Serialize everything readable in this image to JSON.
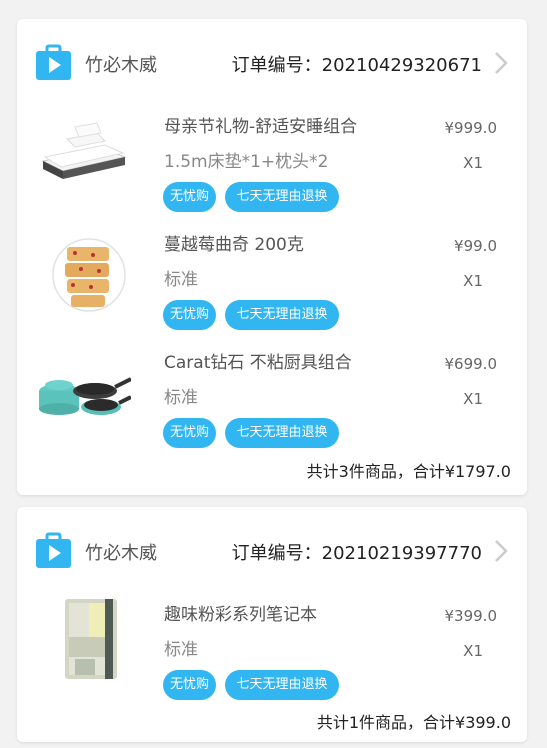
{
  "colors": {
    "accent": "#31b6f2",
    "background": "#f2f2f2",
    "card": "#ffffff"
  },
  "orders": [
    {
      "shop_icon": "play-bag-icon",
      "shop_name": "竹必木威",
      "order_no": "订单编号：20210429320671",
      "items": [
        {
          "image_icon": "bedding-set-image",
          "title": "母亲节礼物-舒适安睡组合",
          "spec": "1.5m床垫*1+枕头*2",
          "tag1": "无忧购",
          "tag2": "七天无理由退换",
          "price": "¥999.0",
          "qty": "X1"
        },
        {
          "image_icon": "cookie-plate-image",
          "title": "蔓越莓曲奇 200克",
          "spec": "标准",
          "tag1": "无忧购",
          "tag2": "七天无理由退换",
          "price": "¥99.0",
          "qty": "X1"
        },
        {
          "image_icon": "cookware-set-image",
          "title": "Carat钻石 不粘厨具组合",
          "spec": "标准",
          "tag1": "无忧购",
          "tag2": "七天无理由退换",
          "price": "¥699.0",
          "qty": "X1"
        }
      ],
      "summary": "共计3件商品，合计¥1797.0"
    },
    {
      "shop_icon": "play-bag-icon",
      "shop_name": "竹必木威",
      "order_no": "订单编号：20210219397770",
      "items": [
        {
          "image_icon": "notebook-image",
          "title": "趣味粉彩系列笔记本",
          "spec": "标准",
          "tag1": "无忧购",
          "tag2": "七天无理由退换",
          "price": "¥399.0",
          "qty": "X1"
        }
      ],
      "summary": "共计1件商品，合计¥399.0"
    }
  ]
}
